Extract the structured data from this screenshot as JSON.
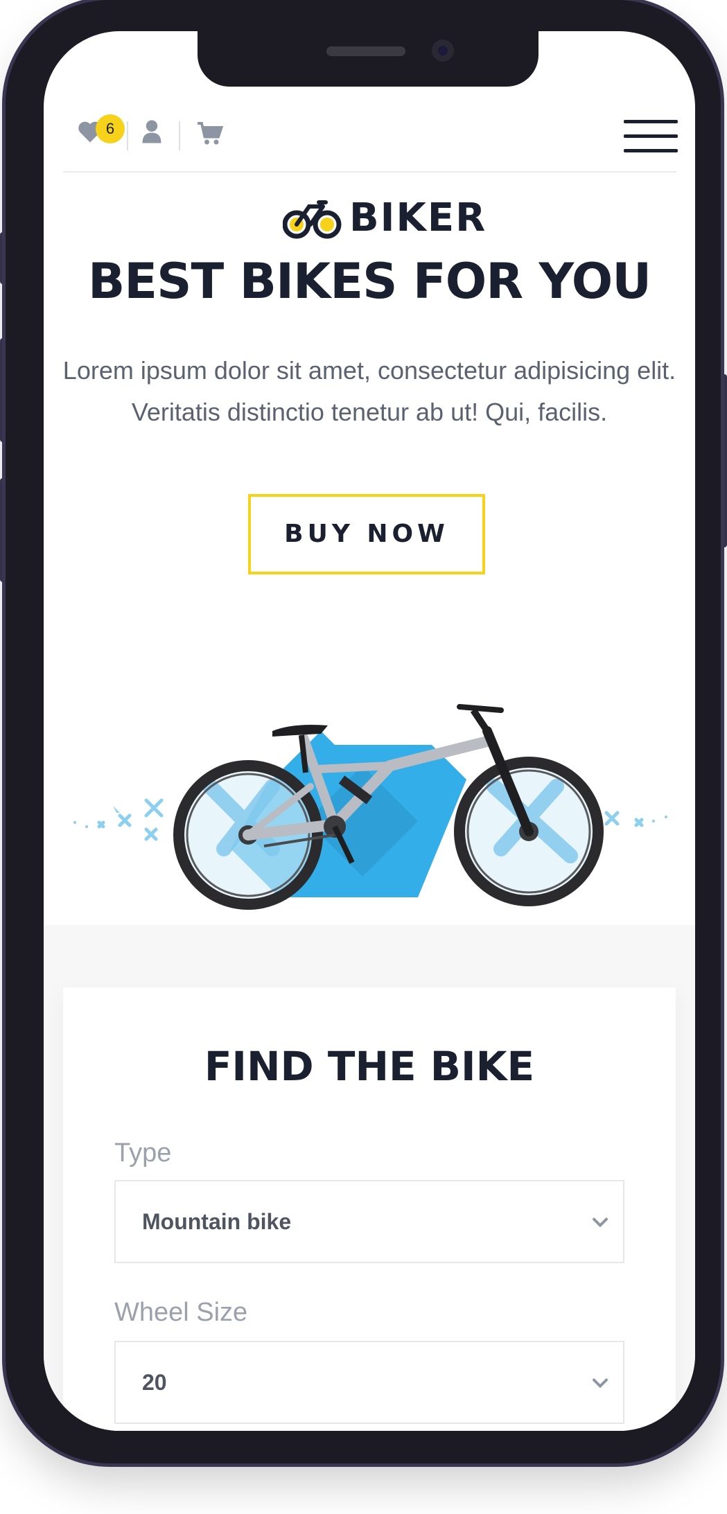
{
  "header": {
    "wishlist_count": "6",
    "icons": [
      "heart-icon",
      "user-icon",
      "cart-icon",
      "hamburger-menu-icon"
    ]
  },
  "brand": {
    "name": "BIKER"
  },
  "hero": {
    "title": "BEST BIKES FOR YOU",
    "text": "Lorem ipsum dolor sit amet, consectetur adipisicing elit. Veritatis distinctio tenetur ab ut! Qui, facilis.",
    "button_label": "BUY NOW"
  },
  "finder": {
    "title": "FIND THE BIKE",
    "type_label": "Type",
    "type_value": "Mountain bike",
    "wheel_label": "Wheel Size",
    "wheel_value": "20"
  },
  "colors": {
    "accent_yellow": "#f6d21b",
    "dark_text": "#1a2030",
    "bike_blue": "#34aee8",
    "frame": "#1c1a22"
  }
}
